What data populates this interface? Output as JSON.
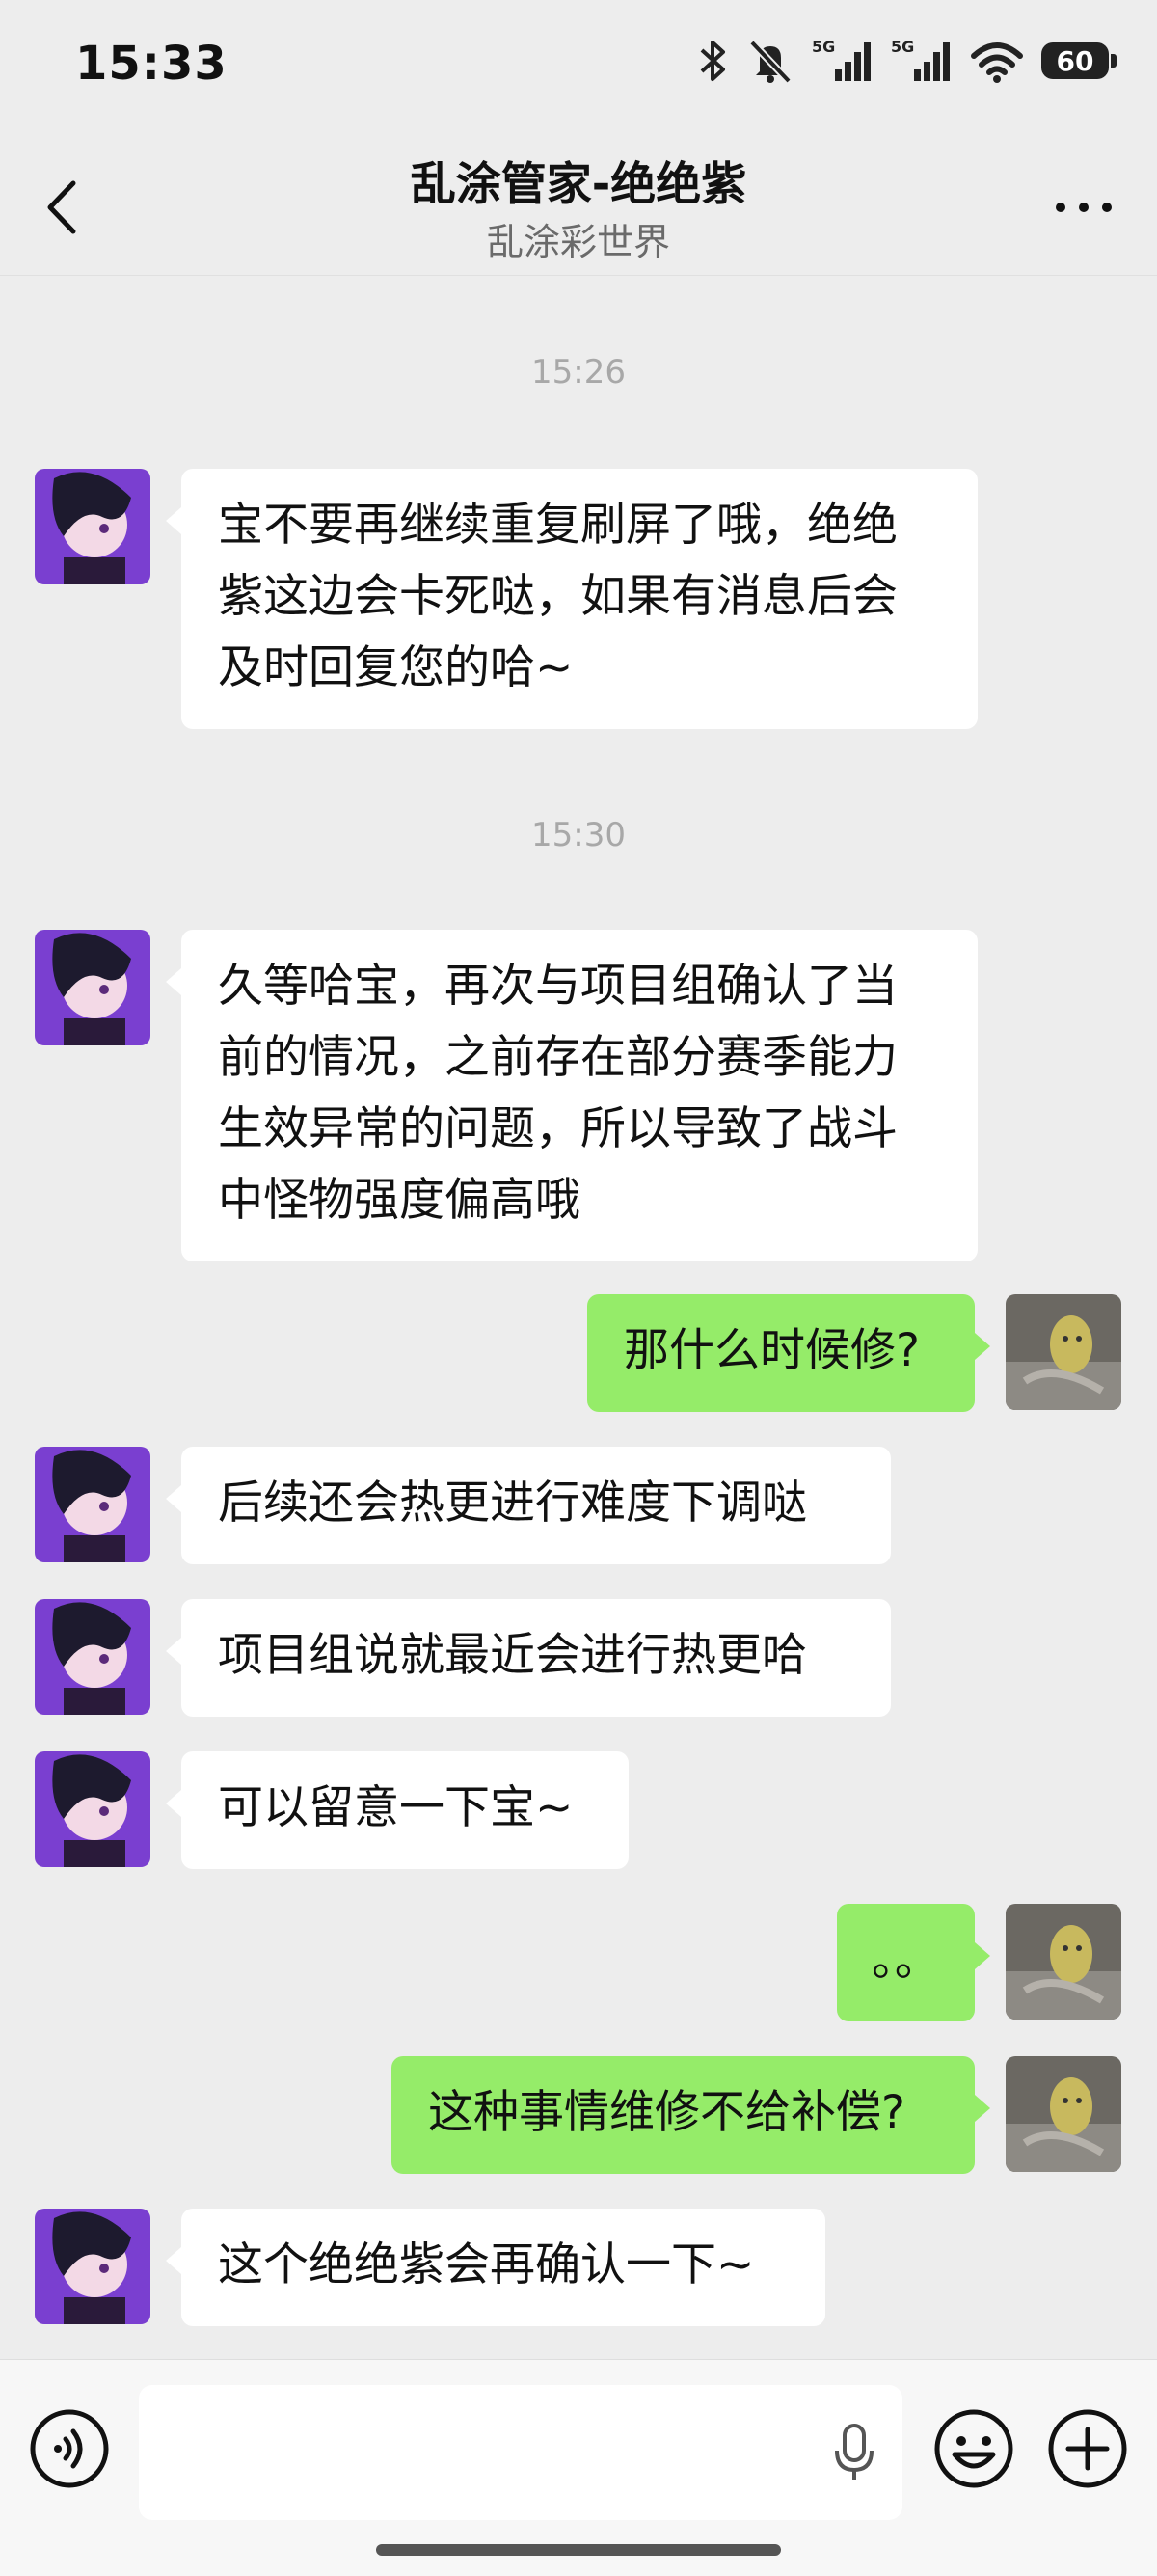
{
  "status_bar": {
    "time": "15:33",
    "battery": "60",
    "network": "5G"
  },
  "header": {
    "title": "乱涂管家-绝绝紫",
    "subtitle": "乱涂彩世界"
  },
  "timestamps": [
    "15:26",
    "15:30"
  ],
  "messages": [
    {
      "from": "agent",
      "text": "宝不要再继续重复刷屏了哦，绝绝紫这边会卡死哒，如果有消息后会及时回复您的哈~"
    },
    {
      "from": "agent",
      "text": "久等哈宝，再次与项目组确认了当前的情况，之前存在部分赛季能力生效异常的问题，所以导致了战斗中怪物强度偏高哦"
    },
    {
      "from": "me",
      "text": "那什么时候修?"
    },
    {
      "from": "agent",
      "text": "后续还会热更进行难度下调哒"
    },
    {
      "from": "agent",
      "text": "项目组说就最近会进行热更哈"
    },
    {
      "from": "agent",
      "text": "可以留意一下宝~"
    },
    {
      "from": "me",
      "text": "。。"
    },
    {
      "from": "me",
      "text": "这种事情维修不给补偿?"
    },
    {
      "from": "agent",
      "text": "这个绝绝紫会再确认一下~"
    }
  ],
  "colors": {
    "background": "#ededed",
    "out_bubble": "#95ec69",
    "in_bubble": "#ffffff"
  },
  "icons": [
    "back-icon",
    "more-icon",
    "voice-icon",
    "mic-icon",
    "emoji-icon",
    "plus-icon",
    "bluetooth-icon",
    "mute-icon",
    "signal-icon",
    "wifi-icon",
    "battery-icon"
  ]
}
